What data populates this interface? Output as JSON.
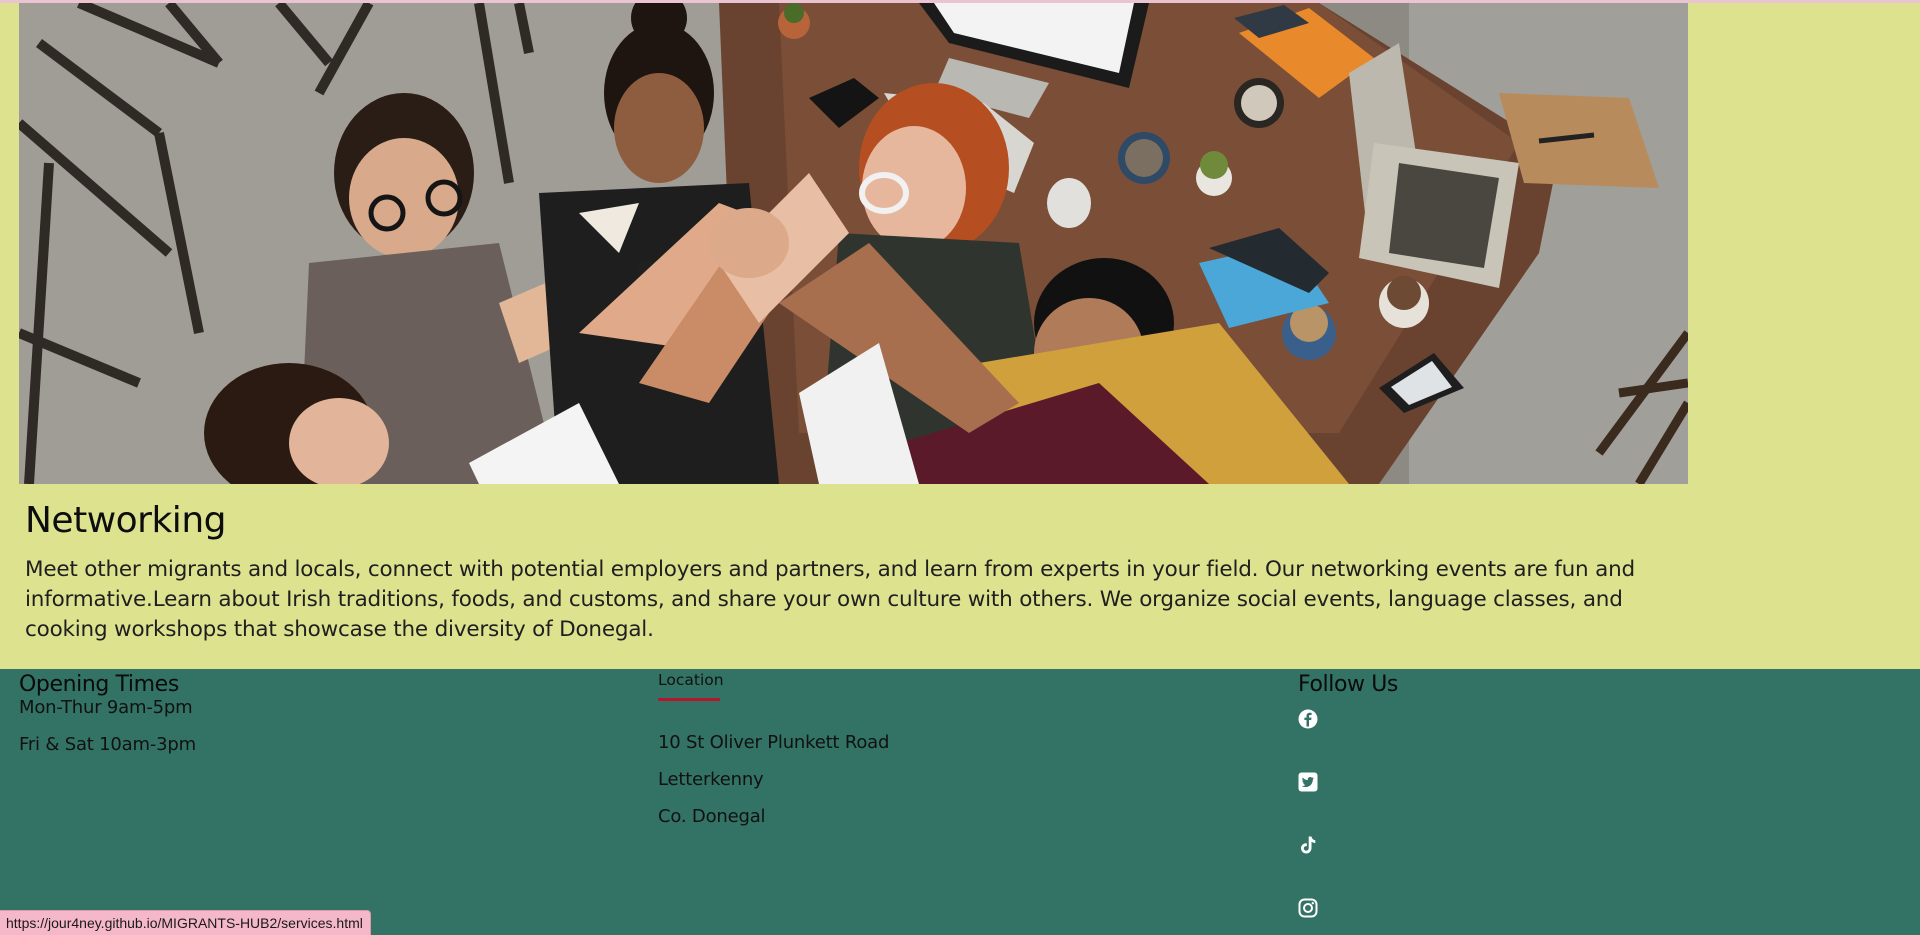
{
  "service": {
    "title": "Networking",
    "description": "Meet other migrants and locals, connect with potential employers and partners, and learn from experts in your field. Our networking events are fun and informative.Learn about Irish traditions, foods, and customs, and share your own culture with others. We organize social events, language classes, and cooking workshops that showcase the diversity of Donegal."
  },
  "footer": {
    "opening": {
      "heading": "Opening Times",
      "lines": [
        "Mon-Thur 9am-5pm",
        "Fri & Sat 10am-3pm"
      ]
    },
    "location": {
      "heading": "Location",
      "lines": [
        "10 St Oliver Plunkett Road",
        "Letterkenny",
        "Co. Donegal"
      ]
    },
    "follow": {
      "heading": "Follow Us",
      "icons": [
        "facebook-icon",
        "twitter-icon",
        "tiktok-icon",
        "instagram-icon"
      ]
    }
  },
  "status_bar": {
    "url": "https://jour4ney.github.io/MIGRANTS-HUB2/services.html"
  },
  "colors": {
    "page_background": "#dde28f",
    "footer_background": "#327365",
    "accent_underline": "#b8132f",
    "status_bar_background": "#f5b8c8"
  }
}
